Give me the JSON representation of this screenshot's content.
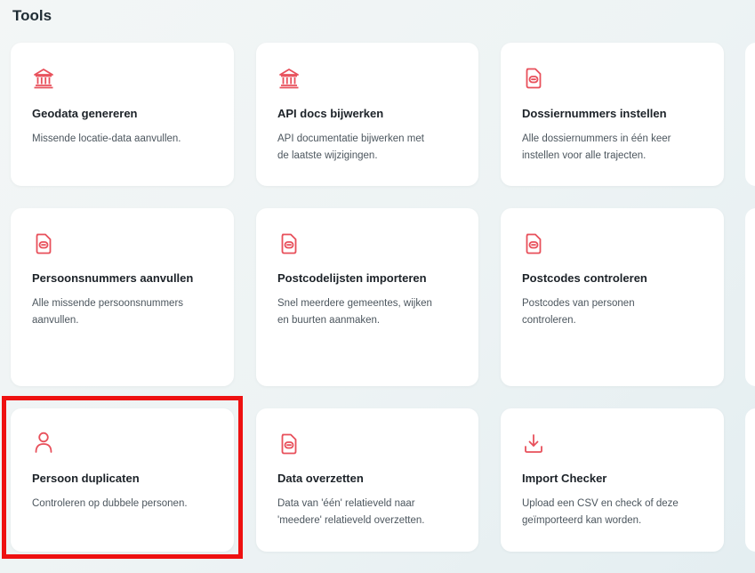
{
  "page": {
    "title": "Tools"
  },
  "colors": {
    "accent": "#e8505b",
    "highlight": "#ee1111"
  },
  "tools": [
    {
      "title": "Geodata genereren",
      "desc_lines": [
        "Missende locatie-data aanvullen."
      ],
      "icon": "bank-icon"
    },
    {
      "title": "API docs bijwerken",
      "desc_lines": [
        "API documentatie bijwerken met",
        "de laatste wijzigingen."
      ],
      "icon": "bank-icon"
    },
    {
      "title": "Dossiernummers instellen",
      "desc_lines": [
        "Alle dossiernummers in één keer",
        "instellen voor alle trajecten."
      ],
      "icon": "document-icon"
    },
    {
      "title": "Persoonsnummers aanvullen",
      "desc_lines": [
        "Alle missende persoonsnummers",
        "aanvullen."
      ],
      "icon": "document-icon"
    },
    {
      "title": "Postcodelijsten importeren",
      "desc_lines": [
        "Snel meerdere gemeentes, wijken",
        "en buurten aanmaken."
      ],
      "icon": "document-icon"
    },
    {
      "title": "Postcodes controleren",
      "desc_lines": [
        "Postcodes van personen",
        "controleren."
      ],
      "icon": "document-icon"
    },
    {
      "title": "Persoon duplicaten",
      "desc_lines": [
        "Controleren op dubbele personen."
      ],
      "icon": "person-icon"
    },
    {
      "title": "Data overzetten",
      "desc_lines": [
        "Data van 'één' relatieveld naar",
        "'meedere' relatieveld overzetten."
      ],
      "icon": "document-icon"
    },
    {
      "title": "Import Checker",
      "desc_lines": [
        "Upload een CSV en check of deze",
        "geïmporteerd kan worden."
      ],
      "icon": "download-icon"
    }
  ]
}
